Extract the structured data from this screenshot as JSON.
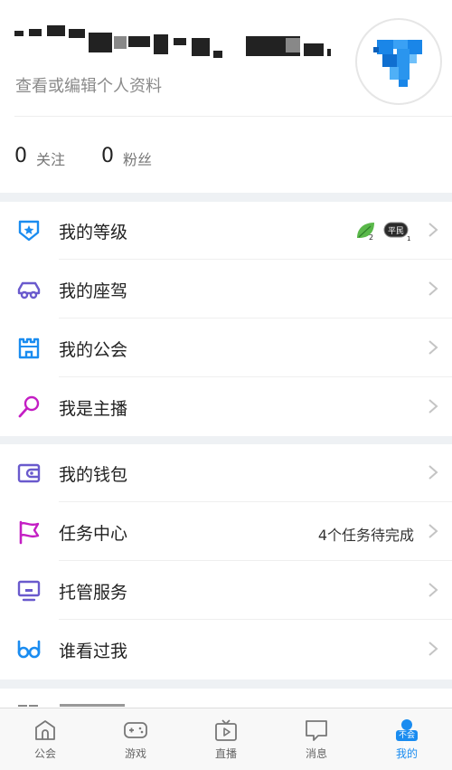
{
  "profile": {
    "subtitle": "查看或编辑个人资料"
  },
  "stats": {
    "following_count": "0",
    "following_label": "关注",
    "fans_count": "0",
    "fans_label": "粉丝"
  },
  "menu_group_1": [
    {
      "label": "我的等级",
      "icon": "shield-star-icon"
    },
    {
      "label": "我的座驾",
      "icon": "car-icon"
    },
    {
      "label": "我的公会",
      "icon": "castle-icon"
    },
    {
      "label": "我是主播",
      "icon": "microphone-icon"
    }
  ],
  "level_badges": {
    "leaf_level": "2",
    "pill_text": "平民",
    "pill_level": "1"
  },
  "menu_group_2": [
    {
      "label": "我的钱包",
      "icon": "wallet-icon"
    },
    {
      "label": "任务中心",
      "icon": "flag-icon",
      "extra": "4个任务待完成"
    },
    {
      "label": "托管服务",
      "icon": "monitor-icon"
    },
    {
      "label": "谁看过我",
      "icon": "glasses-icon"
    }
  ],
  "tabbar": {
    "items": [
      {
        "label": "公会",
        "icon": "guild-icon"
      },
      {
        "label": "游戏",
        "icon": "gamepad-icon"
      },
      {
        "label": "直播",
        "icon": "tv-play-icon"
      },
      {
        "label": "消息",
        "icon": "message-bubble-icon"
      },
      {
        "label": "我的",
        "icon": "profile-icon",
        "active": true,
        "badge": "不会玩"
      }
    ]
  },
  "colors": {
    "accent_blue": "#1a8cf0",
    "purple": "#6a5acd",
    "magenta": "#c41ec4",
    "gap_gray": "#eef1f4"
  }
}
